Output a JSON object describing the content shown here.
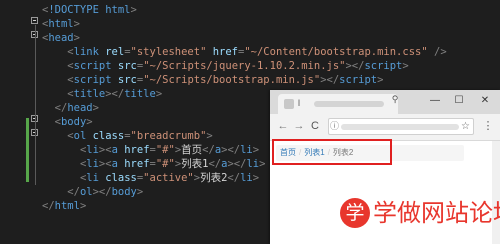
{
  "editor": {
    "lines": [
      {
        "parts": [
          [
            "punc",
            "<"
          ],
          [
            "tag",
            "!DOCTYPE html"
          ],
          [
            "punc",
            ">"
          ]
        ]
      },
      {
        "parts": [
          [
            "punc",
            "<"
          ],
          [
            "tag",
            "html"
          ],
          [
            "punc",
            ">"
          ]
        ]
      },
      {
        "parts": [
          [
            "punc",
            "<"
          ],
          [
            "tag",
            "head"
          ],
          [
            "punc",
            ">"
          ]
        ]
      },
      {
        "parts": [
          [
            "text",
            "    "
          ],
          [
            "punc",
            "<"
          ],
          [
            "tag",
            "link "
          ],
          [
            "attr",
            "rel"
          ],
          [
            "punc",
            "="
          ],
          [
            "str",
            "\"stylesheet\" "
          ],
          [
            "attr",
            "href"
          ],
          [
            "punc",
            "="
          ],
          [
            "str",
            "\"~/Content/bootstrap.min.css\""
          ],
          [
            "punc",
            " />"
          ]
        ]
      },
      {
        "parts": [
          [
            "text",
            "    "
          ],
          [
            "punc",
            "<"
          ],
          [
            "tag",
            "script "
          ],
          [
            "attr",
            "src"
          ],
          [
            "punc",
            "="
          ],
          [
            "str",
            "\"~/Scripts/jquery-1.10.2.min.js\""
          ],
          [
            "punc",
            "></"
          ],
          [
            "tag",
            "script"
          ],
          [
            "punc",
            ">"
          ]
        ]
      },
      {
        "parts": [
          [
            "text",
            "    "
          ],
          [
            "punc",
            "<"
          ],
          [
            "tag",
            "script "
          ],
          [
            "attr",
            "src"
          ],
          [
            "punc",
            "="
          ],
          [
            "str",
            "\"~/Scripts/bootstrap.min.js\""
          ],
          [
            "punc",
            "></"
          ],
          [
            "tag",
            "script"
          ],
          [
            "punc",
            ">"
          ]
        ]
      },
      {
        "parts": [
          [
            "text",
            "    "
          ],
          [
            "punc",
            "<"
          ],
          [
            "tag",
            "title"
          ],
          [
            "punc",
            "></"
          ],
          [
            "tag",
            "title"
          ],
          [
            "punc",
            ">"
          ]
        ]
      },
      {
        "parts": [
          [
            "text",
            "  "
          ],
          [
            "punc",
            "</"
          ],
          [
            "tag",
            "head"
          ],
          [
            "punc",
            ">"
          ]
        ]
      },
      {
        "parts": [
          [
            "text",
            "  "
          ],
          [
            "punc",
            "<"
          ],
          [
            "tag",
            "body"
          ],
          [
            "punc",
            ">"
          ]
        ]
      },
      {
        "parts": [
          [
            "text",
            "    "
          ],
          [
            "punc",
            "<"
          ],
          [
            "tag",
            "ol "
          ],
          [
            "attr",
            "class"
          ],
          [
            "punc",
            "="
          ],
          [
            "str",
            "\"breadcrumb\""
          ],
          [
            "punc",
            ">"
          ]
        ]
      },
      {
        "parts": [
          [
            "text",
            "      "
          ],
          [
            "punc",
            "<"
          ],
          [
            "tag",
            "li"
          ],
          [
            "punc",
            "><"
          ],
          [
            "tag",
            "a "
          ],
          [
            "attr",
            "href"
          ],
          [
            "punc",
            "="
          ],
          [
            "str",
            "\"#\""
          ],
          [
            "punc",
            ">"
          ],
          [
            "text",
            "首页"
          ],
          [
            "punc",
            "</"
          ],
          [
            "tag",
            "a"
          ],
          [
            "punc",
            "></"
          ],
          [
            "tag",
            "li"
          ],
          [
            "punc",
            ">"
          ]
        ]
      },
      {
        "parts": [
          [
            "text",
            "      "
          ],
          [
            "punc",
            "<"
          ],
          [
            "tag",
            "li"
          ],
          [
            "punc",
            "><"
          ],
          [
            "tag",
            "a "
          ],
          [
            "attr",
            "href"
          ],
          [
            "punc",
            "="
          ],
          [
            "str",
            "\"#\""
          ],
          [
            "punc",
            ">"
          ],
          [
            "text",
            "列表1"
          ],
          [
            "punc",
            "</"
          ],
          [
            "tag",
            "a"
          ],
          [
            "punc",
            "></"
          ],
          [
            "tag",
            "li"
          ],
          [
            "punc",
            ">"
          ]
        ]
      },
      {
        "parts": [
          [
            "text",
            "      "
          ],
          [
            "punc",
            "<"
          ],
          [
            "tag",
            "li "
          ],
          [
            "attr",
            "class"
          ],
          [
            "punc",
            "="
          ],
          [
            "str",
            "\"active\""
          ],
          [
            "punc",
            ">"
          ],
          [
            "text",
            "列表2"
          ],
          [
            "punc",
            "</"
          ],
          [
            "tag",
            "li"
          ],
          [
            "punc",
            ">"
          ]
        ]
      },
      {
        "parts": [
          [
            "text",
            "    "
          ],
          [
            "punc",
            "</"
          ],
          [
            "tag",
            "ol"
          ],
          [
            "punc",
            "></"
          ],
          [
            "tag",
            "body"
          ],
          [
            "punc",
            ">"
          ]
        ]
      },
      {
        "parts": [
          [
            "punc",
            "</"
          ],
          [
            "tag",
            "html"
          ],
          [
            "punc",
            ">"
          ]
        ]
      }
    ]
  },
  "browser": {
    "tab_title": "l",
    "profile_icon": "person-icon",
    "window_buttons": [
      "—",
      "☐",
      "✕"
    ],
    "nav": {
      "back": "←",
      "forward": "→",
      "reload": "C",
      "info": "ⓘ"
    },
    "star": "☆",
    "menu": "⋮",
    "breadcrumb": {
      "items": [
        {
          "label": "首页",
          "link": true
        },
        {
          "label": "列表1",
          "link": true
        },
        {
          "label": "列表2",
          "link": false
        }
      ],
      "separator": "/"
    }
  },
  "watermark": {
    "badge": "学",
    "text": "学做网站论坛"
  },
  "colors": {
    "editor_bg": "#1e1e1e",
    "tag": "#569cd6",
    "attr": "#9cdcfe",
    "string": "#ce9178",
    "highlight": "#e02020",
    "link": "#337ab7",
    "watermark": "#e8362d"
  }
}
